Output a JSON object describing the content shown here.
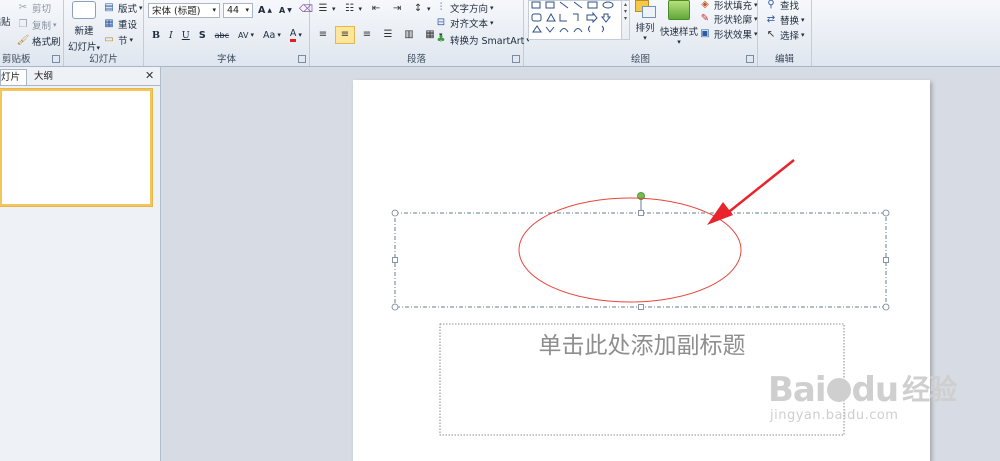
{
  "ribbon": {
    "clipboard": {
      "paste_label": "粘贴",
      "cut_label": "剪切",
      "copy_label": "复制",
      "format_painter_label": "格式刷",
      "group_label": "剪贴板"
    },
    "slides": {
      "new_slide_label": "新建",
      "new_slide_sub": "幻灯片",
      "layout_label": "版式",
      "reset_label": "重设",
      "section_label": "节",
      "group_label": "幻灯片"
    },
    "font": {
      "font_name": "宋体 (标题)",
      "font_size": "44",
      "group_label": "字体"
    },
    "paragraph": {
      "text_direction_label": "文字方向",
      "align_text_label": "对齐文本",
      "smartart_label": "转换为 SmartArt",
      "group_label": "段落"
    },
    "drawing": {
      "arrange_label": "排列",
      "quick_styles_label": "快速样式",
      "shape_fill_label": "形状填充",
      "shape_outline_label": "形状轮廓",
      "shape_effects_label": "形状效果",
      "group_label": "绘图"
    },
    "editing": {
      "find_label": "查找",
      "replace_label": "替换",
      "select_label": "选择",
      "group_label": "编辑"
    }
  },
  "panel": {
    "tab_slides": "灯片",
    "tab_outline": "大纲",
    "close_symbol": "✕"
  },
  "slide": {
    "subtitle_placeholder": "单击此处添加副标题"
  },
  "watermark": {
    "brand": "Bai",
    "brand2": "du",
    "brand_cn": "经验",
    "url": "jingyan.baidu.com"
  },
  "colors": {
    "ellipse": "#e8453c",
    "arrow": "#e8232c",
    "rotate_handle": "#6cc24a",
    "watermark": "#c9c9c9"
  }
}
